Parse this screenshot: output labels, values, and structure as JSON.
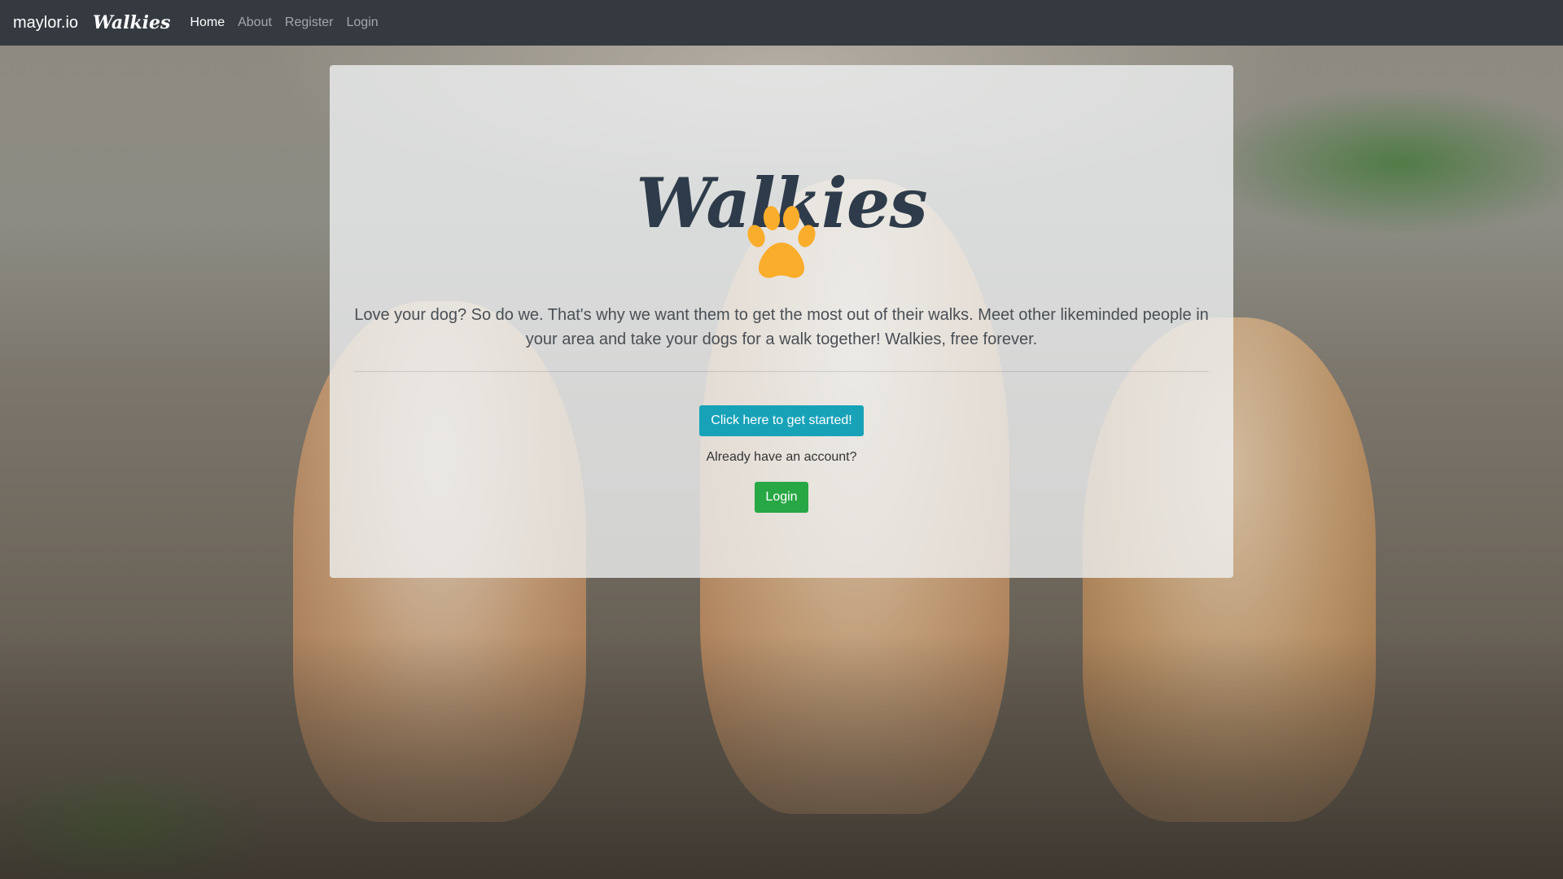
{
  "navbar": {
    "brand": "maylor.io",
    "app_name": "Walkies",
    "links": [
      {
        "label": "Home",
        "active": true
      },
      {
        "label": "About",
        "active": false
      },
      {
        "label": "Register",
        "active": false
      },
      {
        "label": "Login",
        "active": false
      }
    ]
  },
  "hero": {
    "title": "Walkies",
    "icon": "paw-icon",
    "lead": "Love your dog? So do we. That's why we want them to get the most out of their walks. Meet other likeminded people in your area and take your dogs for a walk together! Walkies, free forever.",
    "start_button": "Click here to get started!",
    "account_prompt": "Already have an account?",
    "login_button": "Login"
  },
  "colors": {
    "navbar": "#343a40",
    "paw": "#f9ad2b",
    "start_button": "#17a2b8",
    "login_button": "#28a745"
  }
}
